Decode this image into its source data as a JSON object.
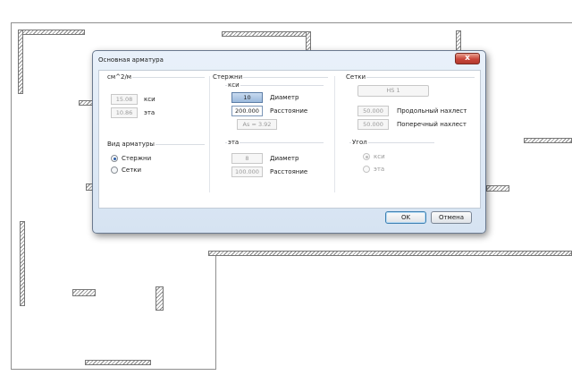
{
  "dialog": {
    "title": "Основная арматура",
    "close_glyph": "x",
    "ok_label": "OK",
    "cancel_label": "Отмена"
  },
  "area": {
    "group_label": "см^2/м",
    "xi_value": "15.08",
    "xi_label": "кси",
    "eta_value": "10.86",
    "eta_label": "эта"
  },
  "rebar_type": {
    "group_label": "Вид арматуры",
    "option_bars": "Стержни",
    "option_meshes": "Сетки",
    "selected": "Стержни"
  },
  "bars": {
    "group_label": "Стержни",
    "xi_group_label": "кси",
    "xi_diameter_value": "10",
    "xi_diameter_label": "Диаметр",
    "xi_spacing_value": "200.000",
    "xi_spacing_label": "Расстояние",
    "as_value": "As = 3.92",
    "eta_group_label": "эта",
    "eta_diameter_value": "8",
    "eta_diameter_label": "Диаметр",
    "eta_spacing_value": "100.000",
    "eta_spacing_label": "Расстояние"
  },
  "meshes": {
    "group_label": "Сетки",
    "mesh_value": "HS 1",
    "long_overlap_value": "50.000",
    "long_overlap_label": "Продольный нахлест",
    "trans_overlap_value": "50.000",
    "trans_overlap_label": "Поперечный нахлест",
    "angle_group_label": "Угол",
    "angle_xi": "кси",
    "angle_eta": "эта",
    "angle_selected": "кси"
  },
  "colors": {
    "dialog_bg": "#d6e3f2",
    "close_button": "#c9463a",
    "selected_field": "#9bb9dc",
    "drawing_lines": "#8f8f8f"
  },
  "icons": {
    "close": "close-icon",
    "radio": "radio-button",
    "hatch": "hatched-wall"
  }
}
